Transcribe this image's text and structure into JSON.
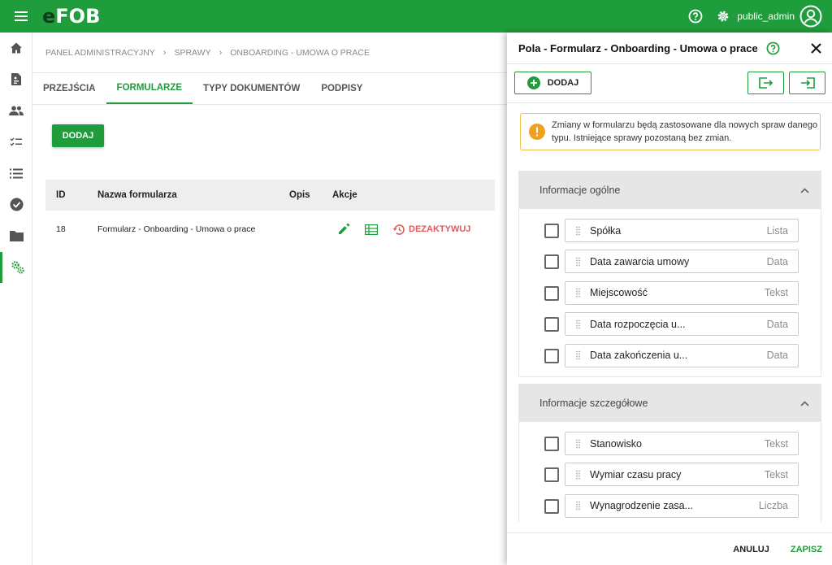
{
  "app": {
    "logo_e": "e",
    "logo_rest": "FOB",
    "username": "public_admin"
  },
  "sidebar": {
    "items": [
      {
        "icon": "home-icon"
      },
      {
        "icon": "document-icon"
      },
      {
        "icon": "users-icon"
      },
      {
        "icon": "checklist-icon"
      },
      {
        "icon": "list-icon"
      },
      {
        "icon": "check-circle-icon"
      },
      {
        "icon": "folder-icon"
      },
      {
        "icon": "settings-gears-icon",
        "active": true
      }
    ]
  },
  "breadcrumb": [
    "PANEL ADMINISTRACYJNY",
    "SPRAWY",
    "ONBOARDING - UMOWA O PRACE"
  ],
  "tabs": [
    {
      "label": "PRZEJŚCIA",
      "active": false
    },
    {
      "label": "FORMULARZE",
      "active": true
    },
    {
      "label": "TYPY DOKUMENTÓW",
      "active": false
    },
    {
      "label": "PODPISY",
      "active": false
    }
  ],
  "main": {
    "add_label": "DODAJ",
    "table": {
      "headers": {
        "id": "ID",
        "name": "Nazwa formularza",
        "opis": "Opis",
        "akcje": "Akcje"
      },
      "rows": [
        {
          "id": "18",
          "name": "Formularz - Onboarding - Umowa o prace",
          "opis": "",
          "deactivate_label": "DEZAKTYWUJ"
        }
      ]
    }
  },
  "drawer": {
    "title": "Pola - Formularz - Onboarding - Umowa o prace",
    "add_label": "DODAJ",
    "notice": "Zmiany w formularzu będą zastosowane dla nowych spraw danego typu. Istniejące sprawy pozostaną bez zmian.",
    "sections": [
      {
        "title": "Informacje ogólne",
        "fields": [
          {
            "name": "Spółka",
            "type": "Lista"
          },
          {
            "name": "Data zawarcia umowy",
            "type": "Data"
          },
          {
            "name": "Miejscowość",
            "type": "Tekst"
          },
          {
            "name": "Data rozpoczęcia u...",
            "type": "Data"
          },
          {
            "name": "Data zakończenia u...",
            "type": "Data"
          }
        ]
      },
      {
        "title": "Informacje szczegółowe",
        "fields": [
          {
            "name": "Stanowisko",
            "type": "Tekst"
          },
          {
            "name": "Wymiar czasu pracy",
            "type": "Tekst"
          },
          {
            "name": "Wynagrodzenie zasa...",
            "type": "Liczba"
          }
        ]
      }
    ],
    "footer": {
      "cancel_label": "ANULUJ",
      "save_label": "ZAPISZ"
    }
  },
  "colors": {
    "primary": "#1f9d3c",
    "danger": "#e05a5a",
    "warning": "#f0a020"
  }
}
